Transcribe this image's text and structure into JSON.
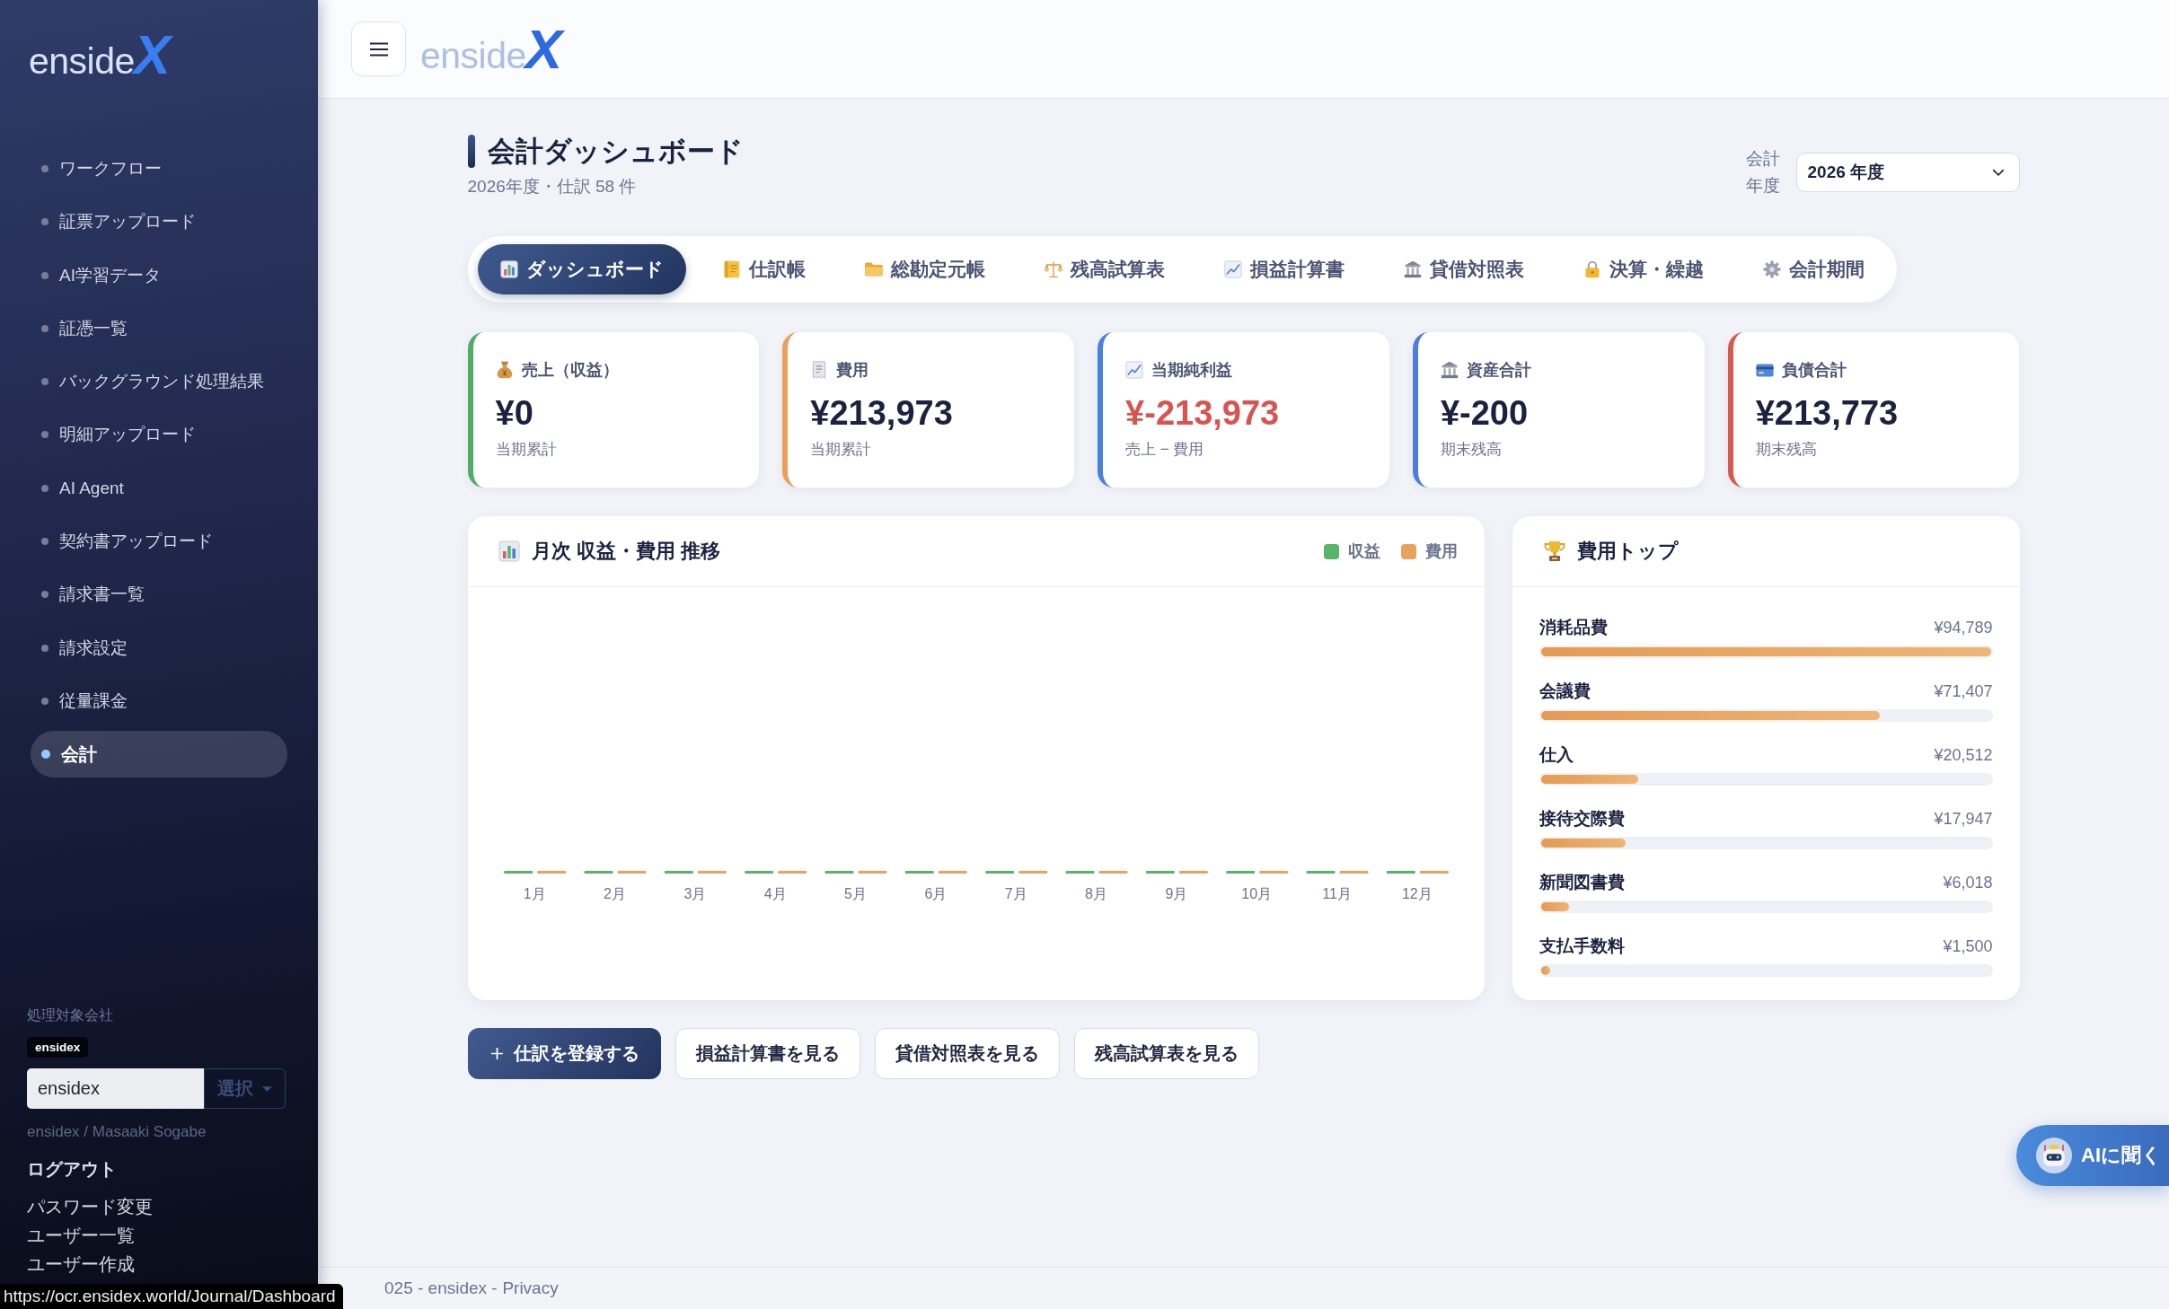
{
  "sidebar": {
    "logo": {
      "text": "enside",
      "mark": "X"
    },
    "nav": [
      {
        "label": "ワークフロー",
        "selected": false
      },
      {
        "label": "証票アップロード",
        "selected": false
      },
      {
        "label": "AI学習データ",
        "selected": false
      },
      {
        "label": "証憑一覧",
        "selected": false
      },
      {
        "label": "バックグラウンド処理結果",
        "selected": false
      },
      {
        "label": "明細アップロード",
        "selected": false
      },
      {
        "label": "AI Agent",
        "selected": false
      },
      {
        "label": "契約書アップロード",
        "selected": false
      },
      {
        "label": "請求書一覧",
        "selected": false
      },
      {
        "label": "請求設定",
        "selected": false
      },
      {
        "label": "従量課金",
        "selected": false
      },
      {
        "label": "会計",
        "selected": true
      }
    ],
    "company": {
      "label": "処理対象会社",
      "badge": "ensidex",
      "input": {
        "value": "ensidex"
      },
      "select_button": "選択"
    },
    "user": "ensidex / Masaaki Sogabe",
    "logout": "ログアウト",
    "links": [
      "パスワード変更",
      "ユーザー一覧",
      "ユーザー作成"
    ]
  },
  "header": {
    "logo": {
      "text": "enside",
      "mark": "X"
    }
  },
  "page": {
    "title": "会計ダッシュボード",
    "subtitle": "2026年度・仕訳 58 件",
    "year_label": "会計年度",
    "year_select": "2026 年度"
  },
  "tabs": [
    {
      "label": "ダッシュボード",
      "kind": "dashboard",
      "selected": true
    },
    {
      "label": "仕訳帳",
      "kind": "journal",
      "selected": false
    },
    {
      "label": "総勘定元帳",
      "kind": "ledger",
      "selected": false
    },
    {
      "label": "残高試算表",
      "kind": "trial-balance",
      "selected": false
    },
    {
      "label": "損益計算書",
      "kind": "income-statement",
      "selected": false
    },
    {
      "label": "貸借対照表",
      "kind": "balance-sheet",
      "selected": false
    },
    {
      "label": "決算・繰越",
      "kind": "closing",
      "selected": false
    },
    {
      "label": "会計期間",
      "kind": "period",
      "selected": false
    }
  ],
  "kpis": [
    {
      "kind": "revenue",
      "label": "売上（収益）",
      "value": "¥0",
      "note": "当期累計",
      "color": "#4fae66",
      "alert": false
    },
    {
      "kind": "expense",
      "label": "費用",
      "value": "¥213,973",
      "note": "当期累計",
      "color": "#e9a05a",
      "alert": false
    },
    {
      "kind": "profit",
      "label": "当期純利益",
      "value": "¥-213,973",
      "note": "売上 − 費用",
      "color": "#4a7fe0",
      "alert": true
    },
    {
      "kind": "assets",
      "label": "資産合計",
      "value": "¥-200",
      "note": "期末残高",
      "color": "#4a7fe0",
      "alert": false
    },
    {
      "kind": "liabilities",
      "label": "負債合計",
      "value": "¥213,773",
      "note": "期末残高",
      "color": "#d65a50",
      "alert": false
    }
  ],
  "monthly_chart": {
    "title": "月次 収益・費用 推移",
    "legend": [
      {
        "label": "収益",
        "color": "#56b46b"
      },
      {
        "label": "費用",
        "color": "#e9a25e"
      }
    ],
    "months": [
      "1月",
      "2月",
      "3月",
      "4月",
      "5月",
      "6月",
      "7月",
      "8月",
      "9月",
      "10月",
      "11月",
      "12月"
    ]
  },
  "expense_top": {
    "title": "費用トップ",
    "items": [
      {
        "name": "消耗品費",
        "amount": "¥94,789",
        "level": 1.0
      },
      {
        "name": "会議費",
        "amount": "¥71,407",
        "level": 0.753
      },
      {
        "name": "仕入",
        "amount": "¥20,512",
        "level": 0.216
      },
      {
        "name": "接待交際費",
        "amount": "¥17,947",
        "level": 0.189
      },
      {
        "name": "新聞図書費",
        "amount": "¥6,018",
        "level": 0.063
      },
      {
        "name": "支払手数料",
        "amount": "¥1,500",
        "level": 0.016
      }
    ]
  },
  "actions": [
    {
      "label": "仕訳を登録する",
      "kind": "primary"
    },
    {
      "label": "損益計算書を見る",
      "kind": "secondary"
    },
    {
      "label": "貸借対照表を見る",
      "kind": "secondary"
    },
    {
      "label": "残高試算表を見る",
      "kind": "secondary"
    }
  ],
  "ai_button": {
    "label": "AIに聞く"
  },
  "footer": {
    "text": "025 - ensidex -",
    "link": "Privacy"
  },
  "status_url": "https://ocr.ensidex.world/Journal/Dashboard"
}
